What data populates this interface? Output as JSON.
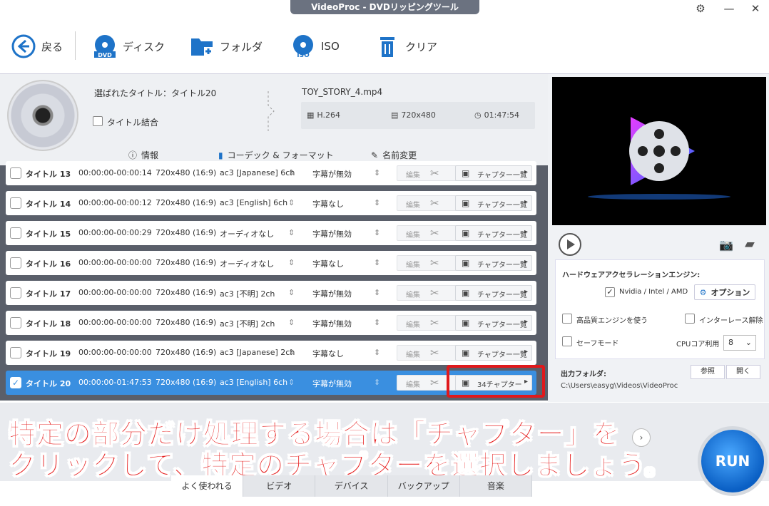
{
  "window": {
    "title": "VideoProc - DVDリッピングツール"
  },
  "toolbar": {
    "back": "戻る",
    "disc": "ディスク",
    "folder": "フォルダ",
    "iso": "ISO",
    "clear": "クリア"
  },
  "info": {
    "selected_title": "選ばれたタイトル：タイトル20",
    "merge_label": "タイトル結合",
    "file_name": "TOY_STORY_4.mp4",
    "codec": "H.264",
    "resolution": "720x480",
    "duration": "01:47:54",
    "tab_info": "情報",
    "tab_codec": "コーデック & フォーマット",
    "tab_rename": "名前変更"
  },
  "rows": [
    {
      "title": "タイトル 13",
      "time": "00:00:00-00:00:14",
      "res": "720x480 (16:9)",
      "audio": "ac3 [Japanese] 6ch",
      "sub": "字幕が無効",
      "edit": "編集",
      "chapter": "チャプター一覧",
      "checked": false
    },
    {
      "title": "タイトル 14",
      "time": "00:00:00-00:00:12",
      "res": "720x480 (16:9)",
      "audio": "ac3 [English] 6ch",
      "sub": "字幕なし",
      "edit": "編集",
      "chapter": "チャプター一覧",
      "checked": false
    },
    {
      "title": "タイトル 15",
      "time": "00:00:00-00:00:29",
      "res": "720x480 (16:9)",
      "audio": "オーディオなし",
      "sub": "字幕が無効",
      "edit": "編集",
      "chapter": "チャプター一覧",
      "checked": false
    },
    {
      "title": "タイトル 16",
      "time": "00:00:00-00:00:00",
      "res": "720x480 (16:9)",
      "audio": "オーディオなし",
      "sub": "字幕なし",
      "edit": "編集",
      "chapter": "チャプター一覧",
      "checked": false
    },
    {
      "title": "タイトル 17",
      "time": "00:00:00-00:00:00",
      "res": "720x480 (16:9)",
      "audio": "ac3 [不明] 2ch",
      "sub": "字幕が無効",
      "edit": "編集",
      "chapter": "チャプター一覧",
      "checked": false
    },
    {
      "title": "タイトル 18",
      "time": "00:00:00-00:00:00",
      "res": "720x480 (16:9)",
      "audio": "ac3 [不明] 2ch",
      "sub": "字幕が無効",
      "edit": "編集",
      "chapter": "チャプター一覧",
      "checked": false
    },
    {
      "title": "タイトル 19",
      "time": "00:00:00-00:00:00",
      "res": "720x480 (16:9)",
      "audio": "ac3 [Japanese] 2ch",
      "sub": "字幕なし",
      "edit": "編集",
      "chapter": "チャプター一覧",
      "checked": false
    },
    {
      "title": "タイトル 20",
      "time": "00:00:00-01:47:53",
      "res": "720x480 (16:9)",
      "audio": "ac3 [English] 6ch",
      "sub": "字幕が無効",
      "edit": "編集",
      "chapter": "34チャプター",
      "checked": true
    }
  ],
  "right": {
    "hw_title": "ハードウェアアクセラレーションエンジン:",
    "hw_vendor": "Nvidia / Intel / AMD",
    "option": "オプション",
    "hq_engine": "高品質エンジンを使う",
    "deinterlace": "インターレース解除",
    "safe_mode": "セーフモード",
    "cpu_label": "CPUコア利用",
    "cpu_value": "8",
    "out_label": "出力フォルダ:",
    "browse": "参照",
    "open": "開く",
    "out_path": "C:\\Users\\easyg\\Videos\\VideoProc"
  },
  "caption": {
    "line1": "特定の部分だけ処理する場合は「チャプター」を",
    "line2": "クリックして、特定のチャプターを選択しましょう。"
  },
  "bottom_tabs": [
    "よく使われる",
    "ビデオ",
    "デバイス",
    "バックアップ",
    "音楽"
  ],
  "run": "RUN",
  "colors": {
    "accent": "#3a8fe0",
    "caption": "#e61e1e",
    "highlight": "#e0191c",
    "run": "#0a5fc4"
  }
}
